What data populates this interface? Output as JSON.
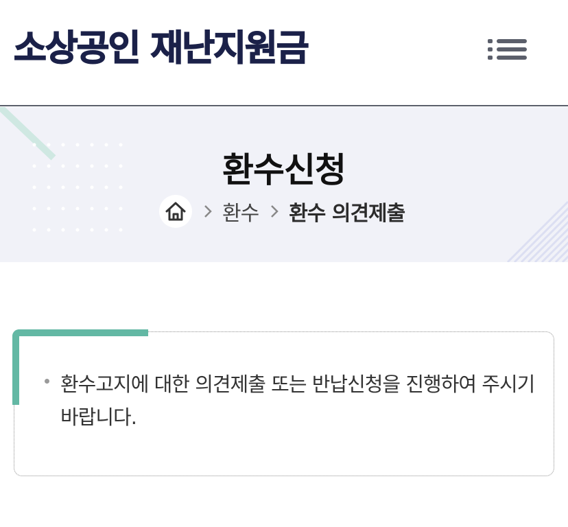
{
  "header": {
    "logo_text": "소상공인 재난지원금",
    "menu_icon": "list-menu-icon"
  },
  "banner": {
    "title": "환수신청",
    "breadcrumb": {
      "home_icon": "home-icon",
      "items": [
        "환수",
        "환수 의견제출"
      ]
    }
  },
  "notice": {
    "text": "환수고지에 대한 의견제출 또는 반납신청을 진행하여 주시기 바랍니다."
  },
  "colors": {
    "brand_navy": "#1b2149",
    "accent_teal": "#63b8a4",
    "banner_bg": "#f1f2f8"
  }
}
